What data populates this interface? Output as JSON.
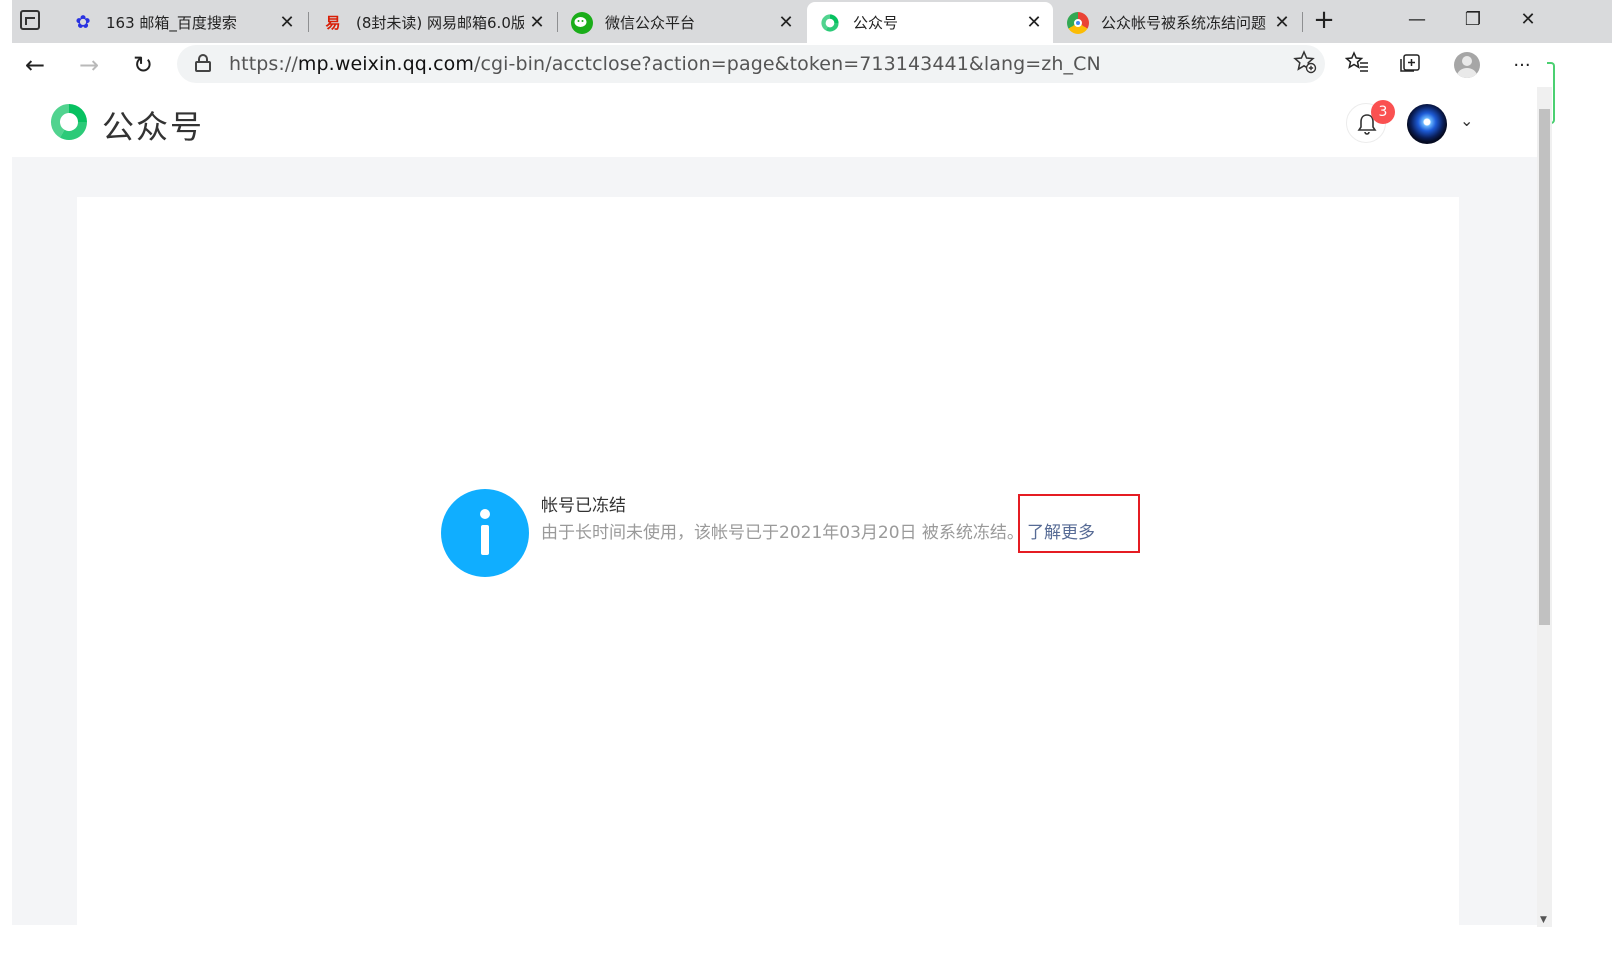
{
  "browser": {
    "tabs": [
      {
        "title": "163 邮箱_百度搜索",
        "icon": "baidu-paw-icon",
        "active": false
      },
      {
        "title": "(8封未读) 网易邮箱6.0版",
        "icon": "netease-mail-icon",
        "active": false
      },
      {
        "title": "微信公众平台",
        "icon": "wechat-icon",
        "active": false
      },
      {
        "title": "公众号",
        "icon": "mp-logo-icon",
        "active": true
      },
      {
        "title": "公众帐号被系统冻结问题",
        "icon": "chrome-icon",
        "active": false
      }
    ],
    "close_glyph": "✕",
    "new_tab_glyph": "+",
    "window_controls": {
      "minimize": "—",
      "restore": "❐",
      "close": "✕"
    },
    "url": {
      "prefix": "https://",
      "host": "mp.weixin.qq.com",
      "path": "/cgi-bin/acctclose?action=page&token=713143441&lang=zh_CN"
    },
    "nav": {
      "back": "←",
      "forward": "→",
      "refresh": "↻"
    },
    "toolbar": {
      "favorites": "☆",
      "collections": "⧉",
      "more": "···"
    }
  },
  "page": {
    "brand": "公众号",
    "notification_count": "3",
    "account_menu_caret": "⌄",
    "message": {
      "title": "帐号已冻结",
      "description": "由于长时间未使用，该帐号已于2021年03月20日   被系统冻结。",
      "link": "了解更多"
    }
  },
  "colors": {
    "brand_green": "#07c160",
    "info_blue": "#10aeff",
    "link": "#576b95",
    "badge_red": "#fa5151",
    "annotation_red": "#e51c23"
  }
}
